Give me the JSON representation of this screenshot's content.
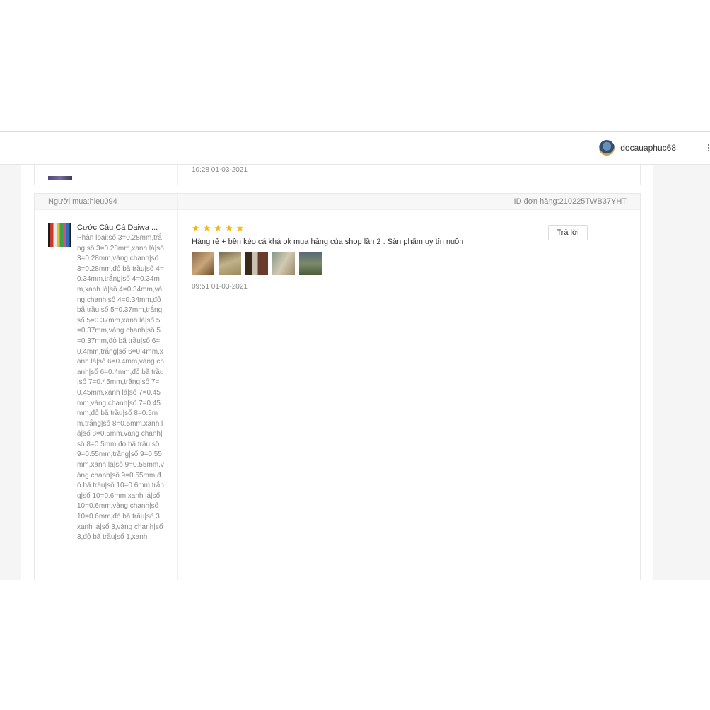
{
  "topbar": {
    "username": "docauaphuc68"
  },
  "prev_review": {
    "time": "10:28 01-03-2021"
  },
  "review": {
    "buyer": "Người mua:hieu094",
    "order_id": "ID đơn hàng:210225TWB37YHT",
    "product_name": "Cước Câu Cá Daiwa ...",
    "variant": "Phân loại:số 3=0.28mm,trắng|số 3=0.28mm,xanh lá|số 3=0.28mm,vàng chanh|số 3=0.28mm,đỏ bã trầu|số 4=0.34mm,trắng|số 4=0.34mm,xanh lá|số 4=0.34mm,vàng chanh|số 4=0.34mm,đỏ bã trầu|số 5=0.37mm,trắng|số 5=0.37mm,xanh lá|số 5=0.37mm,vàng chanh|số 5=0.37mm,đỏ bã trầu|số 6=0.4mm,trắng|số 6=0.4mm,xanh lá|số 6=0.4mm,vàng chanh|số 6=0.4mm,đỏ bã trầu|số 7=0.45mm,trắng|số 7=0.45mm,xanh lá|số 7=0.45mm,vàng chanh|số 7=0.45mm,đỏ bã trầu|số 8=0.5mm,trắng|số 8=0.5mm,xanh lá|số 8=0.5mm,vàng chanh|số 8=0.5mm,đỏ bã trầu|số 9=0.55mm,trắng|số 9=0.55mm,xanh lá|số 9=0.55mm,vàng chanh|số 9=0.55mm,đỏ bã trầu|số 10=0.6mm,trắng|số 10=0.6mm,xanh lá|số 10=0.6mm,vàng chanh|số 10=0.6mm,đỏ bã trầu|số 3,xanh lá|số 3,vàng chanh|số 3,đỏ bã trầu|số 1,xanh",
    "rating": 5,
    "stars": [
      "★",
      "★",
      "★",
      "★",
      "★"
    ],
    "comment": "Hàng rẻ + bền kéo cá khá ok mua hàng của shop lần 2 . Sản phẩm uy tín nuôn",
    "photo_count": 5,
    "time": "09:51 01-03-2021",
    "reply_label": "Trả lời"
  },
  "colors": {
    "star": "#f5b800",
    "muted_text": "#888888",
    "border": "#e8e8e8"
  }
}
